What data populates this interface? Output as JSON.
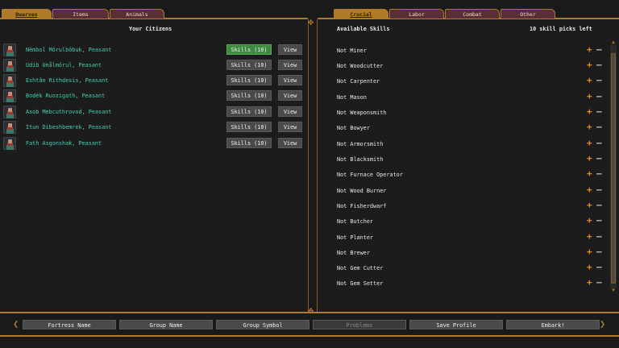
{
  "left_tabs": [
    {
      "label": "Dwarves",
      "active": true
    },
    {
      "label": "Items",
      "active": false
    },
    {
      "label": "Animals",
      "active": false
    }
  ],
  "right_tabs": [
    {
      "label": "Crucial",
      "active": true
    },
    {
      "label": "Labor",
      "active": false
    },
    {
      "label": "Combat",
      "active": false
    },
    {
      "label": "Other",
      "active": false
    }
  ],
  "citizens_panel": {
    "title": "Your Citizens",
    "citizens": [
      {
        "name": "Nëmbol Mörulbôbuk, Peasant",
        "skills_label": "Skills (10)",
        "view_label": "View",
        "selected": true
      },
      {
        "name": "Udib Unålmörul, Peasant",
        "skills_label": "Skills (10)",
        "view_label": "View",
        "selected": false
      },
      {
        "name": "Eshtân Rithdesis, Peasant",
        "skills_label": "Skills (10)",
        "view_label": "View",
        "selected": false
      },
      {
        "name": "Bodék Ruozigath, Peasant",
        "skills_label": "Skills (10)",
        "view_label": "View",
        "selected": false
      },
      {
        "name": "Asob Mebcuthrovod, Peasant",
        "skills_label": "Skills (10)",
        "view_label": "View",
        "selected": false
      },
      {
        "name": "Itun Dibeshbemrek, Peasant",
        "skills_label": "Skills (10)",
        "view_label": "View",
        "selected": false
      },
      {
        "name": "Fath Asgonshak, Peasant",
        "skills_label": "Skills (10)",
        "view_label": "View",
        "selected": false
      }
    ]
  },
  "skills_panel": {
    "title": "Available Skills",
    "picks_left": "10 skill picks left",
    "plus_glyph": "+",
    "minus_glyph": "—",
    "skills": [
      "Not Miner",
      "Not Woodcutter",
      "Not Carpenter",
      "Not Mason",
      "Not Weaponsmith",
      "Not Bowyer",
      "Not Armorsmith",
      "Not Blacksmith",
      "Not Furnace Operator",
      "Not Wood Burner",
      "Not Fisherdwarf",
      "Not Butcher",
      "Not Planter",
      "Not Brewer",
      "Not Gem Cutter",
      "Not Gem Setter"
    ]
  },
  "bottom_buttons": [
    {
      "label": "Fortress Name",
      "disabled": false
    },
    {
      "label": "Group Name",
      "disabled": false
    },
    {
      "label": "Group Symbol",
      "disabled": false
    },
    {
      "label": "Problems",
      "disabled": true
    },
    {
      "label": "Save Profile",
      "disabled": false
    },
    {
      "label": "Embark!",
      "disabled": false
    }
  ],
  "colors": {
    "gold": "#b07a2a",
    "tab_bg": "#5a2e38",
    "citizen_name": "#3fd0b0",
    "plus": "#e08a28",
    "button_green": "#3e8a3e"
  }
}
